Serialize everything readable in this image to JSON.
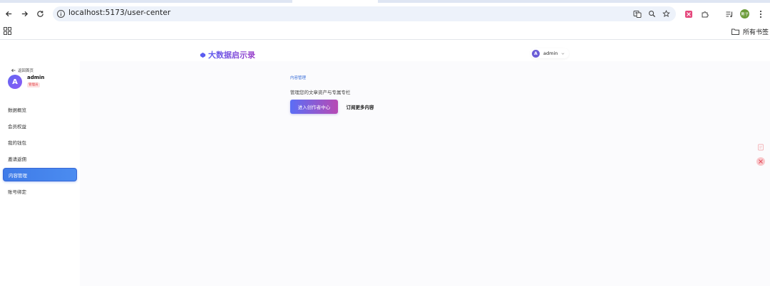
{
  "browser": {
    "url": "localhost:5173/user-center",
    "profile_initials": "黑子",
    "bookmarks_all_label": "所有书签"
  },
  "header": {
    "brand": "大数据启示录",
    "user_initial": "A",
    "user_name": "admin"
  },
  "sidebar": {
    "back_label": "返回首页",
    "avatar_initial": "A",
    "name": "admin",
    "role": "管理员",
    "items": [
      {
        "label": "数据概览"
      },
      {
        "label": "会员权益"
      },
      {
        "label": "我的钱包"
      },
      {
        "label": "邀请返佣"
      },
      {
        "label": "内容管理",
        "active": true
      },
      {
        "label": "账号绑定"
      }
    ]
  },
  "main": {
    "section_title": "内容管理",
    "description": "管理您的文章资产与专属专栏",
    "primary_button": "进入创作者中心",
    "secondary_button": "订阅更多内容"
  },
  "colors": {
    "accent": "#3f7be8",
    "brand_gradient_start": "#5b5cf0",
    "brand_gradient_end": "#9b3fc9",
    "role_badge": "#e0393e"
  }
}
